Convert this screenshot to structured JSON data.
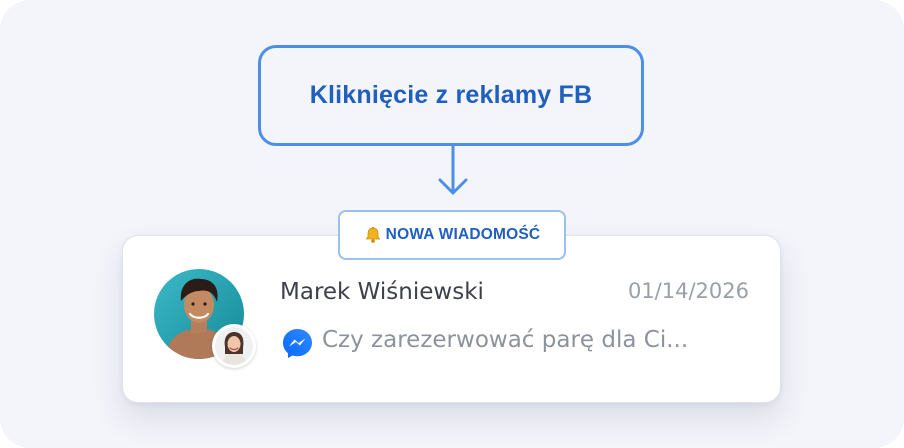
{
  "source": {
    "label": "Kliknięcie z reklamy FB"
  },
  "notification": {
    "badge_label": "NOWA WIADOMOŚĆ",
    "badge_icon": "bell-icon",
    "contact_name": "Marek Wiśniewski",
    "date": "01/14/2026",
    "channel_icon": "messenger-icon",
    "preview": "Czy zarezerwować parę dla Ci..."
  },
  "colors": {
    "accent_blue": "#1f5fbf",
    "border_blue": "#4d8fe6",
    "background": "#f4f5fb"
  }
}
